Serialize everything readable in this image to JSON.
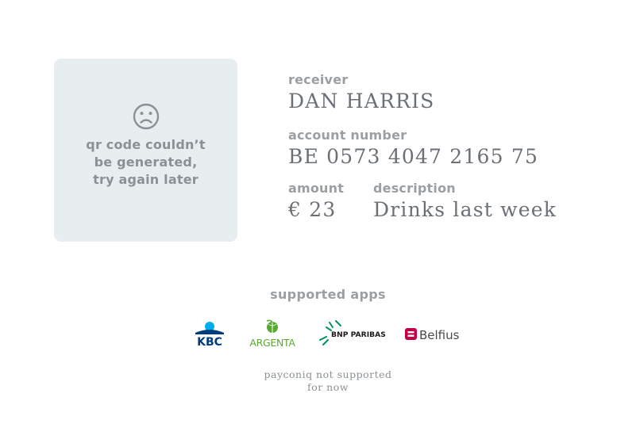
{
  "qr": {
    "icon": "sad-face-icon",
    "message_line1": "qr code couldn’t",
    "message_line2": "be generated,",
    "message_line3": "try again later"
  },
  "receiver": {
    "label": "receiver",
    "value": "DAN HARRIS"
  },
  "account": {
    "label": "account number",
    "value": "BE 0573 4047 2165 75"
  },
  "amount": {
    "label": "amount",
    "value": "€ 23"
  },
  "description": {
    "label": "description",
    "value": "Drinks last week"
  },
  "apps": {
    "title": "supported apps",
    "items": [
      {
        "name": "KBC",
        "icon": "kbc-logo",
        "color": "#003d7c",
        "accent": "#00aeef"
      },
      {
        "name": "ARGENTA",
        "icon": "argenta-logo",
        "color": "#5aa832"
      },
      {
        "name": "BNP PARIBAS",
        "icon": "bnp-paribas-logo",
        "color": "#1a1a1a",
        "accent": "#00915a"
      },
      {
        "name": "Belfius",
        "icon": "belfius-logo",
        "color": "#c30045",
        "text_color": "#4a4a4a"
      }
    ]
  },
  "note": {
    "line1": "payconiq not supported",
    "line2": "for now"
  },
  "colors": {
    "qr_box_bg": "#e8eeef",
    "label": "#9a9fa3",
    "value": "#6a7076"
  }
}
